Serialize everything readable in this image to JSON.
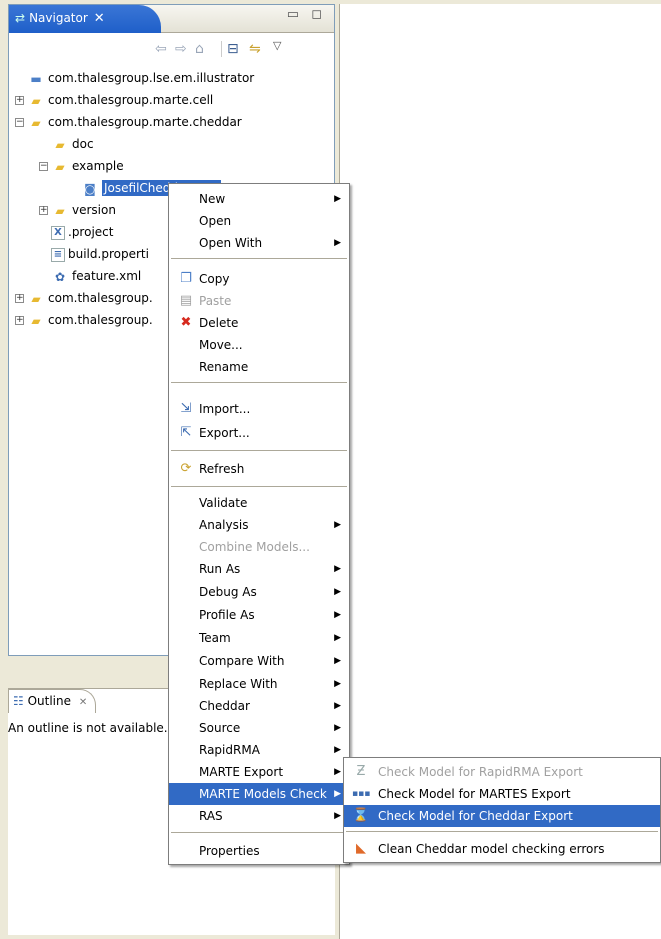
{
  "navigator": {
    "tab_title": "Navigator",
    "tab_close": "✕",
    "window_buttons": "▭ ◻",
    "toolbar_icons": [
      "back-icon",
      "forward-icon",
      "home-icon",
      "collapse-all-icon",
      "link-with-editor-icon",
      "view-menu-icon"
    ],
    "tree": [
      {
        "label": "com.thalesgroup.lse.em.illustrator",
        "icon": "project-icon",
        "expander": "",
        "level": 0
      },
      {
        "label": "com.thalesgroup.marte.cell",
        "icon": "folder-icon",
        "expander": "+",
        "level": 0
      },
      {
        "label": "com.thalesgroup.marte.cheddar",
        "icon": "folder-icon",
        "expander": "−",
        "level": 0
      },
      {
        "label": "doc",
        "icon": "folder-icon",
        "expander": "",
        "level": 1
      },
      {
        "label": "example",
        "icon": "folder-icon",
        "expander": "−",
        "level": 1
      },
      {
        "label": "JosefilCheddar.emx",
        "icon": "model-file-icon",
        "expander": "",
        "level": 2,
        "selected": true
      },
      {
        "label": "version",
        "icon": "folder-icon",
        "expander": "+",
        "level": 1
      },
      {
        "label": ".project",
        "icon": "xml-file-icon",
        "expander": "",
        "level": 1
      },
      {
        "label": "build.properti",
        "icon": "properties-file-icon",
        "expander": "",
        "level": 1
      },
      {
        "label": "feature.xml",
        "icon": "feature-file-icon",
        "expander": "",
        "level": 1
      },
      {
        "label": "com.thalesgroup.",
        "icon": "folder-icon",
        "expander": "+",
        "level": 0
      },
      {
        "label": "com.thalesgroup.",
        "icon": "folder-icon",
        "expander": "+",
        "level": 0
      }
    ]
  },
  "outline": {
    "tab_title": "Outline",
    "tab_close": "✕",
    "message": "An outline is not available."
  },
  "context_menu": {
    "items": [
      {
        "label": "New",
        "submenu": true
      },
      {
        "label": "Open"
      },
      {
        "label": "Open With",
        "submenu": true
      },
      {
        "separator": true
      },
      {
        "label": "Copy",
        "icon": "copy-icon"
      },
      {
        "label": "Paste",
        "icon": "paste-icon",
        "disabled": true
      },
      {
        "label": "Delete",
        "icon": "delete-icon"
      },
      {
        "label": "Move..."
      },
      {
        "label": "Rename"
      },
      {
        "separator": true
      },
      {
        "label": "Import...",
        "icon": "import-icon"
      },
      {
        "label": "Export...",
        "icon": "export-icon"
      },
      {
        "separator": true
      },
      {
        "label": "Refresh",
        "icon": "refresh-icon"
      },
      {
        "separator": true
      },
      {
        "label": "Validate"
      },
      {
        "label": "Analysis",
        "submenu": true
      },
      {
        "label": "Combine Models...",
        "disabled": true
      },
      {
        "label": "Run As",
        "submenu": true
      },
      {
        "label": "Debug As",
        "submenu": true
      },
      {
        "label": "Profile As",
        "submenu": true
      },
      {
        "label": "Team",
        "submenu": true
      },
      {
        "label": "Compare With",
        "submenu": true
      },
      {
        "label": "Replace With",
        "submenu": true
      },
      {
        "label": "Cheddar",
        "submenu": true
      },
      {
        "label": "Source",
        "submenu": true
      },
      {
        "label": "RapidRMA",
        "submenu": true
      },
      {
        "label": "MARTE Export",
        "submenu": true
      },
      {
        "label": "MARTE Models Check",
        "submenu": true,
        "highlighted": true
      },
      {
        "label": "RAS",
        "submenu": true
      },
      {
        "separator": true
      },
      {
        "label": "Properties"
      }
    ]
  },
  "sub_menu": {
    "items": [
      {
        "label": "Check Model for RapidRMA Export",
        "icon": "rapidrma-icon",
        "disabled": true
      },
      {
        "label": "Check Model for MARTES Export",
        "icon": "martes-icon"
      },
      {
        "label": "Check Model for Cheddar Export",
        "icon": "hourglass-icon",
        "highlighted": true
      },
      {
        "separator": true
      },
      {
        "label": "Clean Cheddar model checking errors",
        "icon": "cheese-icon"
      }
    ]
  }
}
